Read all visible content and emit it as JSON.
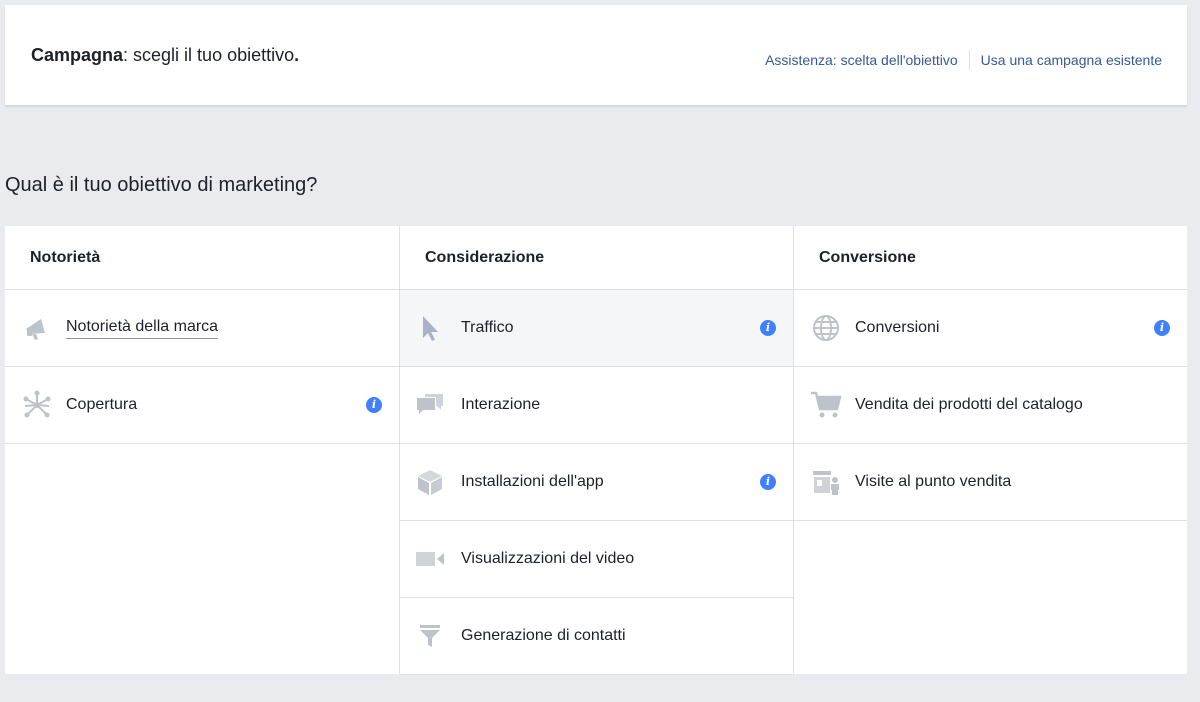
{
  "header": {
    "title_bold": "Campagna",
    "title_rest": ": scegli il tuo obiettivo",
    "title_end": ".",
    "link_help": "Assistenza: scelta dell'obiettivo",
    "link_existing": "Usa una campagna esistente"
  },
  "question": "Qual è il tuo obiettivo di marketing?",
  "columns": [
    {
      "title": "Notorietà",
      "items": [
        {
          "label": "Notorietà della marca",
          "icon": "megaphone-icon"
        },
        {
          "label": "Copertura",
          "icon": "reach-icon",
          "info": "i"
        }
      ]
    },
    {
      "title": "Considerazione",
      "items": [
        {
          "label": "Traffico",
          "icon": "cursor-icon",
          "info": "i",
          "selected": true
        },
        {
          "label": "Interazione",
          "icon": "chat-bubbles-icon"
        },
        {
          "label": "Installazioni dell'app",
          "icon": "box-icon",
          "info": "i"
        },
        {
          "label": "Visualizzazioni del video",
          "icon": "video-camera-icon"
        },
        {
          "label": "Generazione di contatti",
          "icon": "funnel-icon"
        }
      ]
    },
    {
      "title": "Conversione",
      "items": [
        {
          "label": "Conversioni",
          "icon": "globe-icon",
          "info": "i"
        },
        {
          "label": "Vendita dei prodotti del catalogo",
          "icon": "shopping-cart-icon"
        },
        {
          "label": "Visite al punto vendita",
          "icon": "store-visit-icon"
        }
      ]
    }
  ],
  "colors": {
    "background": "#e9ebee",
    "link": "#365899",
    "info_badge": "#4080ff",
    "icon": "#bec3c9",
    "selected_row": "#f5f6f7"
  }
}
